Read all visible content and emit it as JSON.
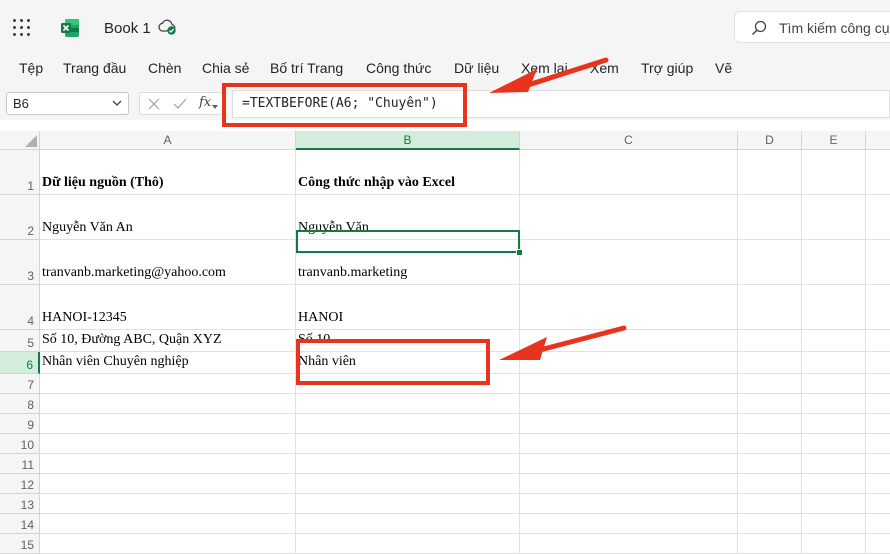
{
  "app": {
    "title": "Book 1",
    "search_placeholder": "Tìm kiếm công cụ,",
    "brand_color": "#107c41",
    "icons": [
      "app-launcher-icon",
      "excel-logo-icon",
      "cloud-saved-icon",
      "search-icon",
      "dropdown-icon",
      "cancel-icon",
      "enter-icon",
      "function-icon"
    ]
  },
  "ribbon": {
    "tabs": [
      "Tệp",
      "Trang đầu",
      "Chèn",
      "Chia sẻ",
      "Bố trí Trang",
      "Công thức",
      "Dữ liệu",
      "Xem lại",
      "Xem",
      "Trợ giúp",
      "Vẽ"
    ]
  },
  "formula_bar": {
    "name_box": "B6",
    "fx_label": "fx",
    "formula": "=TEXTBEFORE(A6; \"Chuyên\")"
  },
  "sheet": {
    "columns": [
      "A",
      "B",
      "C",
      "D",
      "E"
    ],
    "selected_column": "B",
    "selected_row": "6",
    "active_cell": "B6",
    "rows": [
      {
        "num": "1",
        "a": "Dữ liệu nguồn (Thô)",
        "b": "Công thức nhập vào Excel",
        "bold": true
      },
      {
        "num": "2",
        "a": "Nguyễn Văn An",
        "b": "Nguyễn Văn"
      },
      {
        "num": "3",
        "a": "tranvanb.marketing@yahoo.com",
        "b": "tranvanb.marketing"
      },
      {
        "num": "4",
        "a": "HANOI-12345",
        "b": "HANOI"
      },
      {
        "num": "5",
        "a": "Số 10, Đường ABC, Quận XYZ",
        "b": "Số 10"
      },
      {
        "num": "6",
        "a": "Nhân viên Chuyên nghiệp",
        "b": "Nhân viên"
      },
      {
        "num": "7",
        "a": "",
        "b": ""
      },
      {
        "num": "8",
        "a": "",
        "b": ""
      },
      {
        "num": "9",
        "a": "",
        "b": ""
      },
      {
        "num": "10",
        "a": "",
        "b": ""
      },
      {
        "num": "11",
        "a": "",
        "b": ""
      },
      {
        "num": "12",
        "a": "",
        "b": ""
      },
      {
        "num": "13",
        "a": "",
        "b": ""
      },
      {
        "num": "14",
        "a": "",
        "b": ""
      },
      {
        "num": "15",
        "a": "",
        "b": ""
      }
    ]
  },
  "annotation_color": "#e8341c"
}
